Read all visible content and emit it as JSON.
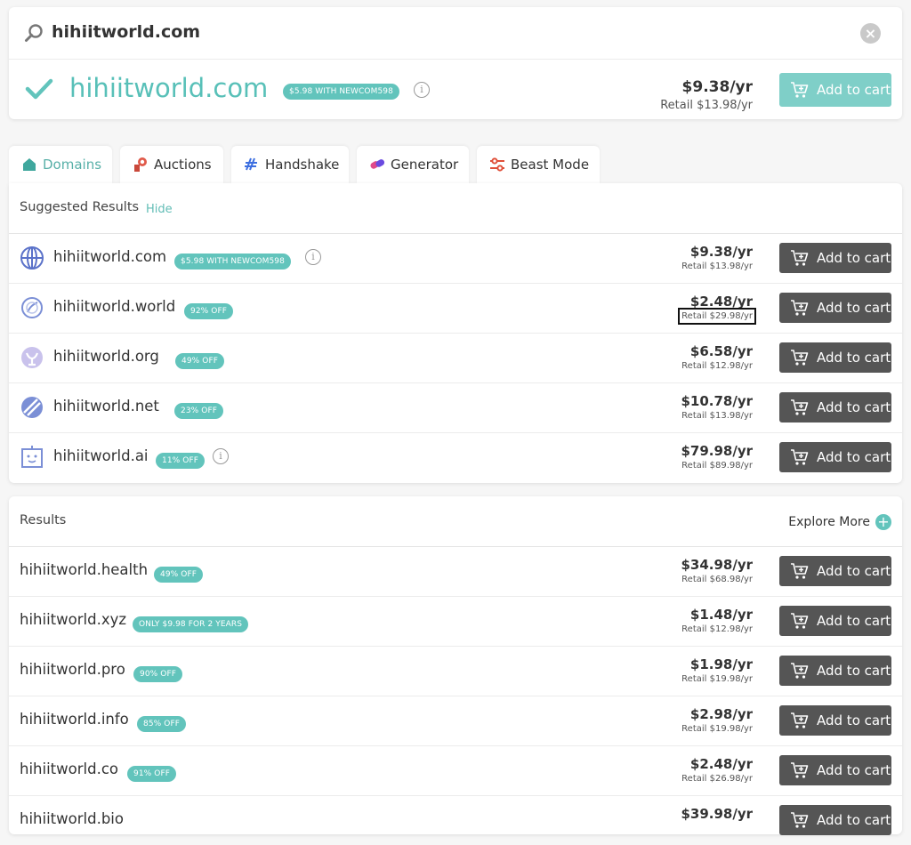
{
  "search": {
    "query": "hihiitworld.com",
    "clear_label": "×"
  },
  "featured": {
    "domain": "hihiitworld.com",
    "badge": "$5.98 WITH NEWCOM598",
    "price": "$9.38/yr",
    "retail": "Retail $13.98/yr",
    "cart_label": "Add to cart"
  },
  "tabs": [
    {
      "label": "Domains",
      "icon": "home-icon"
    },
    {
      "label": "Auctions",
      "icon": "gavel-icon"
    },
    {
      "label": "Handshake",
      "icon": "handshake-icon"
    },
    {
      "label": "Generator",
      "icon": "pills-icon"
    },
    {
      "label": "Beast Mode",
      "icon": "sliders-icon"
    }
  ],
  "suggested": {
    "title": "Suggested Results",
    "hide_label": "Hide",
    "rows": [
      {
        "domain": "hihiitworld.com",
        "badge": "$5.98 WITH NEWCOM598",
        "price": "$9.38/yr",
        "retail": "Retail $13.98/yr",
        "icon": "globe-icon",
        "info": true
      },
      {
        "domain": "hihiitworld.world",
        "badge": "92% OFF",
        "price": "$2.48/yr",
        "retail": "Retail $29.98/yr",
        "icon": "world-icon",
        "info": false
      },
      {
        "domain": "hihiitworld.org",
        "badge": "49% OFF",
        "price": "$6.58/yr",
        "retail": "Retail $12.98/yr",
        "icon": "org-icon",
        "info": false
      },
      {
        "domain": "hihiitworld.net",
        "badge": "23% OFF",
        "price": "$10.78/yr",
        "retail": "Retail $13.98/yr",
        "icon": "net-icon",
        "info": false
      },
      {
        "domain": "hihiitworld.ai",
        "badge": "11% OFF",
        "price": "$79.98/yr",
        "retail": "Retail $89.98/yr",
        "icon": "robot-icon",
        "info": true
      }
    ]
  },
  "results": {
    "title": "Results",
    "explore_label": "Explore More",
    "rows": [
      {
        "domain": "hihiitworld.health",
        "badge": "49% OFF",
        "price": "$34.98/yr",
        "retail": "Retail $68.98/yr"
      },
      {
        "domain": "hihiitworld.xyz",
        "badge": "ONLY $9.98 FOR 2 YEARS",
        "price": "$1.48/yr",
        "retail": "Retail $12.98/yr"
      },
      {
        "domain": "hihiitworld.pro",
        "badge": "90% OFF",
        "price": "$1.98/yr",
        "retail": "Retail $19.98/yr"
      },
      {
        "domain": "hihiitworld.info",
        "badge": "85% OFF",
        "price": "$2.98/yr",
        "retail": "Retail $19.98/yr"
      },
      {
        "domain": "hihiitworld.co",
        "badge": "91% OFF",
        "price": "$2.48/yr",
        "retail": "Retail $26.98/yr"
      },
      {
        "domain": "hihiitworld.bio",
        "badge": "",
        "price": "$39.98/yr",
        "retail": ""
      }
    ]
  },
  "cart_label": "Add to cart",
  "colors": {
    "accent": "#62c4bc",
    "cart_button": "#555555",
    "featured_cart_button": "#7fcfc8"
  }
}
